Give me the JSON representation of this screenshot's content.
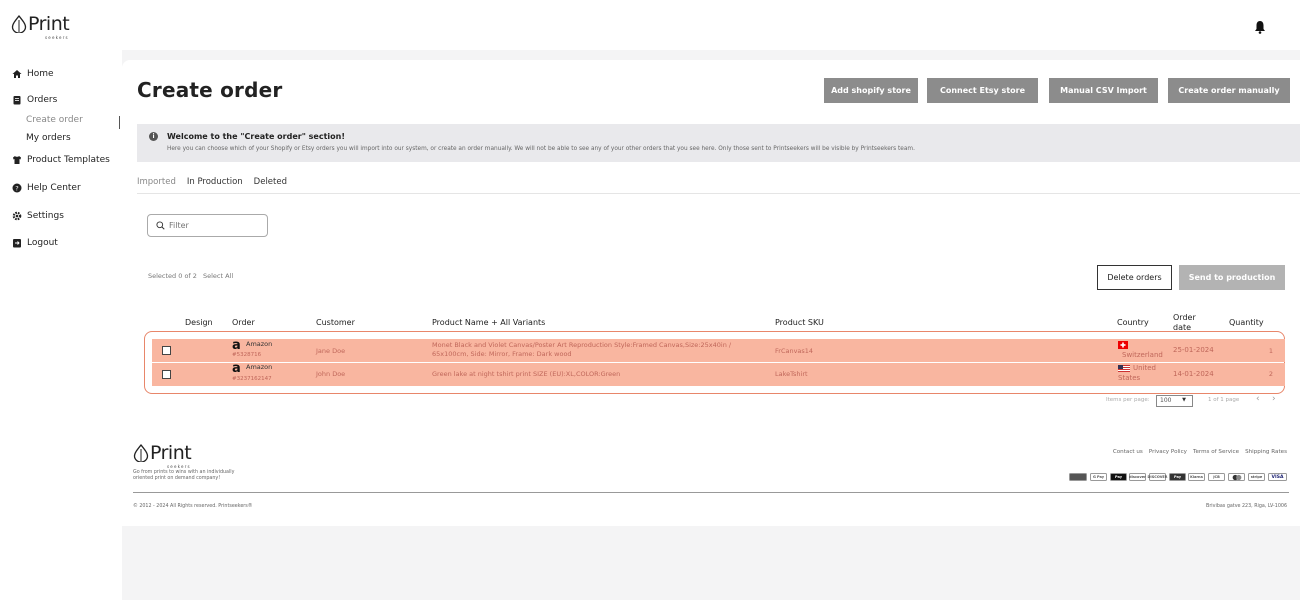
{
  "brand": {
    "name": "Print",
    "tagline": "seekers"
  },
  "sidebar": {
    "items": [
      {
        "label": "Home",
        "icon": "home-icon"
      },
      {
        "label": "Orders",
        "icon": "orders-icon"
      },
      {
        "label": "Product Templates",
        "icon": "shirt-icon"
      },
      {
        "label": "Help Center",
        "icon": "help-icon"
      },
      {
        "label": "Settings",
        "icon": "gear-icon"
      },
      {
        "label": "Logout",
        "icon": "logout-icon"
      }
    ],
    "sub": [
      {
        "label": "Create order"
      },
      {
        "label": "My orders"
      }
    ]
  },
  "header": {
    "title": "Create order",
    "buttons": {
      "shopify": "Add shopify store",
      "etsy": "Connect Etsy store",
      "csv": "Manual CSV Import",
      "manual": "Create order manually"
    }
  },
  "info": {
    "heading": "Welcome to the \"Create order\" section!",
    "text": "Here you can choose which of your Shopify or Etsy orders you will import into our system, or create an order manually. We will not be able to see any of your other orders that you see here. Only those sent to Printseekers will be visible by Printseekers team."
  },
  "tabs": [
    "Imported",
    "In Production",
    "Deleted"
  ],
  "filter": {
    "placeholder": "Filter"
  },
  "selection": {
    "text": "Selected 0 of 2",
    "select_all": "Select All"
  },
  "actions": {
    "delete": "Delete orders",
    "send": "Send to production"
  },
  "table": {
    "headers": {
      "design": "Design",
      "order": "Order",
      "customer": "Customer",
      "product": "Product Name + All Variants",
      "sku": "Product SKU",
      "country": "Country",
      "date": "Order date",
      "qty": "Quantity"
    },
    "rows": [
      {
        "source": "Amazon",
        "order_id": "#5328716",
        "customer": "Jane Doe",
        "product_line1": "Monet Black and Violet Canvas/Poster Art Reproduction Style:Framed Canvas,Size:25x40in /",
        "product_line2": "65x100cm, Side: Mirror, Frame: Dark wood",
        "sku": "FrCanvas14",
        "country": "Switzerland",
        "date": "25-01-2024",
        "qty": "1"
      },
      {
        "source": "Amazon",
        "order_id": "#3237162147",
        "customer": "John Doe",
        "product_line1": "Green lake at night tshirt print SIZE (EU):XL,COLOR:Green",
        "product_line2": "",
        "sku": "LakeTshirt",
        "country_line1": "United",
        "country_line2": "States",
        "date": "14-01-2024",
        "qty": "2"
      }
    ]
  },
  "pagination": {
    "label": "Items per page:",
    "per_page": "100",
    "range": "1 of 1 page"
  },
  "footer": {
    "slogan_line1": "Go from prints to wins with an individually",
    "slogan_line2": "oriented print on demand company!",
    "copyright": "© 2012 - 2024 All Rights reserved. Printseekers®",
    "links": [
      "Contact us",
      "Privacy Policy",
      "Terms of Service",
      "Shipping Rates"
    ],
    "address": "Brivibas gatve 223, Riga, LV-1006",
    "payments": [
      "G Pay",
      "Pay",
      "AMEX",
      "DISCOVER",
      "discover",
      "Pay",
      "Klarna",
      "JCB",
      "",
      "stripe",
      "VISA"
    ]
  },
  "colors": {
    "accent": "#f9b6a0",
    "accent_border": "#e8866a",
    "button_dark": "#8c8c8c"
  }
}
